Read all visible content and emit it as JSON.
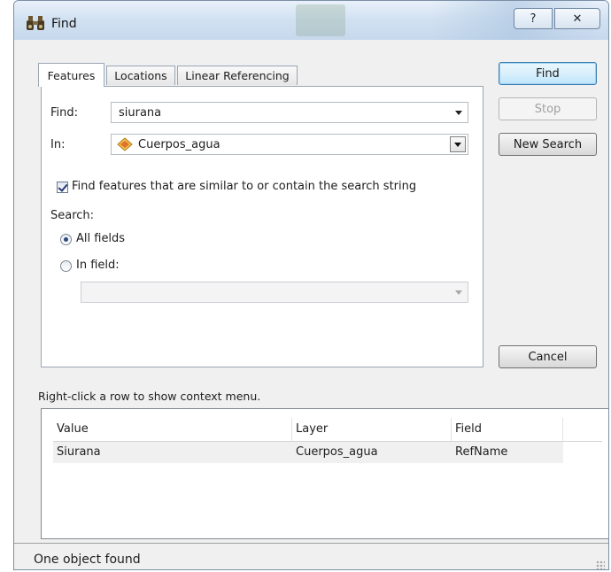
{
  "window": {
    "title": "Find",
    "help_label": "?",
    "close_label": "✕"
  },
  "tabs": [
    {
      "label": "Features",
      "active": true
    },
    {
      "label": "Locations",
      "active": false
    },
    {
      "label": "Linear Referencing",
      "active": false
    }
  ],
  "form": {
    "find_label": "Find:",
    "find_value": "siurana",
    "in_label": "In:",
    "in_value": "Cuerpos_agua",
    "similar_checkbox_label": "Find features that are similar to or contain the search string",
    "similar_checked": true,
    "search_label": "Search:",
    "all_fields_label": "All fields",
    "in_field_label": "In field:",
    "in_field_value": ""
  },
  "buttons": {
    "find": "Find",
    "stop": "Stop",
    "new_search": "New Search",
    "cancel": "Cancel"
  },
  "hint": "Right-click a row to show context menu.",
  "results": {
    "columns": [
      "Value",
      "Layer",
      "Field"
    ],
    "rows": [
      [
        "Siurana",
        "Cuerpos_agua",
        "RefName"
      ]
    ]
  },
  "status": "One object found",
  "colors": {
    "titlebar": "#d3e2f2",
    "default_button": "#bee6fd",
    "dialog_bg": "#f0f0f0"
  }
}
